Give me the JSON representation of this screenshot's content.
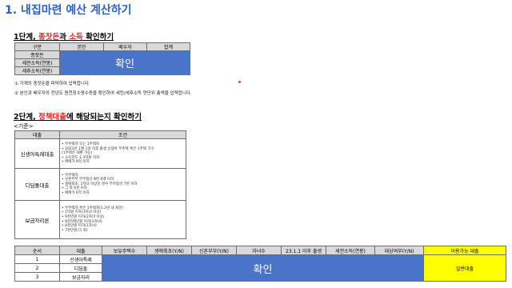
{
  "page": {
    "title": "1. 내집마련 예산 계산하기"
  },
  "step1": {
    "prefix": "1단계, ",
    "highlight1": "종잣돈",
    "connector": "과 ",
    "highlight2": "소득",
    "suffix": " 확인하기",
    "table": {
      "headers": [
        "구분",
        "본인",
        "배우자",
        "합계"
      ],
      "rows": [
        "종잣돈",
        "세전소득(연봉)",
        "세후소득(연봉)"
      ],
      "button_label": "확인"
    },
    "notes": [
      "① 가계의 종잣돈을 파악하여 입력합니다.",
      "② 본인과 배우자의 전년도 원천징수영수증을 확인하여 세전/세후소득 연단위 총액을 입력합니다."
    ]
  },
  "step2": {
    "prefix": "2단계, ",
    "highlight": "정책대출",
    "suffix": "에 해당되는지 확인하기",
    "criteria_label": "<기준>",
    "table": {
      "headers": [
        "대출",
        "조건"
      ],
      "loans": [
        {
          "name": "신생아특례대출",
          "conditions": [
            "• 무주택자 또는 1주택자",
            "• 2023년 1월 1일 이후 출생 신생아 무주택 혹은 1주택 가구",
            "  (1주택은 대환 가능)",
            "• 소득한도 1.3억원 이하",
            "• 매매가 9억 이하"
          ]
        },
        {
          "name": "디딤돌대출",
          "conditions": [
            "• 무주택자",
            "• 신혼부부 부부합산 8천 6백 이하",
            "• 생애최초, 2자녀 이상인 경우 부부합산 7천 이하",
            "• 그 외 6천 이하",
            "• 매매가 6억 이하"
          ]
        },
        {
          "name": "보금자리론",
          "conditions": [
            "• 무주택자 혹은 1주택자(1.2년 내 처분)",
            "• 1억원 이하(3자녀 이상)",
            "• 9천만원 이하(2자녀 이상)",
            "• 8천5백만원 이하(1자녀)",
            "• 8천만원 이하(1자녀)",
            "• 7천만원(그 외)"
          ]
        }
      ]
    }
  },
  "result_table": {
    "headers": [
      "순서",
      "대출",
      "보유주택수",
      "생애최초(Y/N)",
      "신혼부부(Y/N)",
      "자녀수",
      "23.1.1 이후 출생",
      "세전소득(연봉)",
      "대상여부(Y/N)",
      "이용가능 대출"
    ],
    "rows": [
      {
        "order": "1",
        "loan": "신생아특례"
      },
      {
        "order": "2",
        "loan": "디딤돌"
      },
      {
        "order": "3",
        "loan": "보금자리"
      }
    ],
    "button_label": "확인",
    "available_loan": "일반대출"
  },
  "colors": {
    "title_blue": "#2a62c8",
    "accent_red": "#ff2020",
    "button_blue": "#4a74c9",
    "highlight_yellow": "#ffff00",
    "header_gray": "#d9d9d9"
  }
}
